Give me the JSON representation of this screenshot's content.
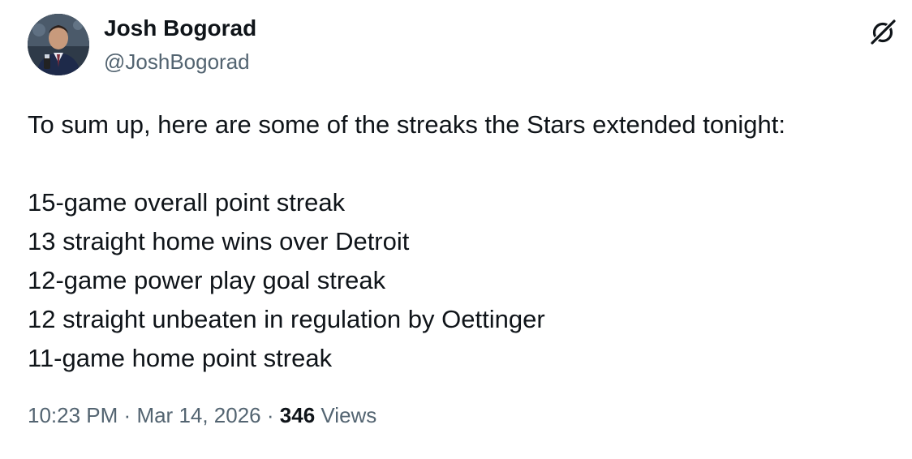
{
  "author": {
    "display_name": "Josh Bogorad",
    "handle": "@JoshBogorad",
    "avatar_icon": "profile-photo"
  },
  "header": {
    "grok_icon": "grok-icon"
  },
  "post": {
    "intro": "To sum up, here are some of the streaks the Stars extended tonight:",
    "lines": [
      "15-game overall point streak",
      "13 straight home wins over Detroit",
      "12-game power play goal streak",
      "12 straight unbeaten in regulation by Oettinger",
      "11-game home point streak"
    ]
  },
  "meta": {
    "time": "10:23 PM",
    "separator": "·",
    "date": "Mar 14, 2026",
    "views_count": "346",
    "views_label": "Views"
  },
  "colors": {
    "text_primary": "#0f1419",
    "text_secondary": "#536471",
    "background": "#ffffff"
  }
}
